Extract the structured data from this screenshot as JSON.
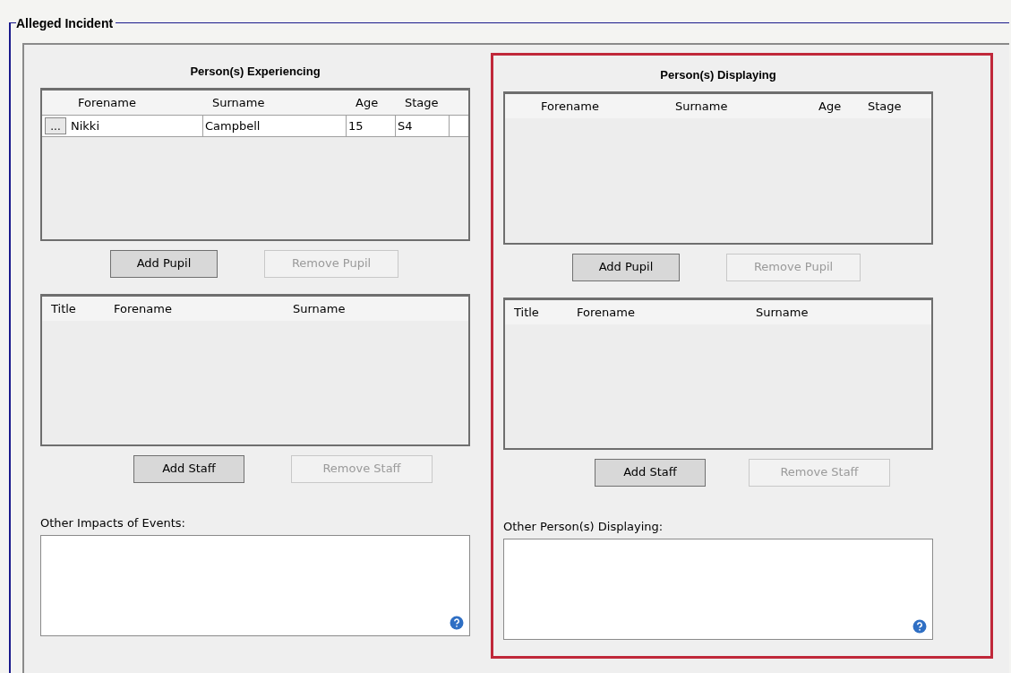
{
  "fieldset": {
    "legend": "Alleged Incident"
  },
  "panels": [
    {
      "title": "Person(s) Experiencing",
      "highlighted": false,
      "pupil_table": {
        "columns": [
          "Forename",
          "Surname",
          "Age",
          "Stage"
        ],
        "rows": [
          {
            "row_button": "...",
            "cells": [
              "Nikki",
              "Campbell",
              "15",
              "S4"
            ]
          }
        ]
      },
      "pupil_buttons": [
        {
          "label": "Add Pupil",
          "disabled": false
        },
        {
          "label": "Remove Pupil",
          "disabled": true
        }
      ],
      "staff_table": {
        "columns": [
          "Title",
          "Forename",
          "Surname"
        ]
      },
      "staff_buttons": [
        {
          "label": "Add Staff",
          "disabled": false
        },
        {
          "label": "Remove Staff",
          "disabled": true
        }
      ],
      "notes": {
        "label": "Other Impacts of Events:"
      }
    },
    {
      "title": "Person(s) Displaying",
      "highlighted": true,
      "pupil_table": {
        "columns": [
          "Forename",
          "Surname",
          "Age",
          "Stage"
        ]
      },
      "pupil_buttons": [
        {
          "label": "Add Pupil",
          "disabled": false
        },
        {
          "label": "Remove Pupil",
          "disabled": true
        }
      ],
      "staff_table": {
        "columns": [
          "Title",
          "Forename",
          "Surname"
        ]
      },
      "staff_buttons": [
        {
          "label": "Add Staff",
          "disabled": false
        },
        {
          "label": "Remove Staff",
          "disabled": true
        }
      ],
      "notes": {
        "label": "Other Person(s) Displaying:"
      }
    }
  ]
}
